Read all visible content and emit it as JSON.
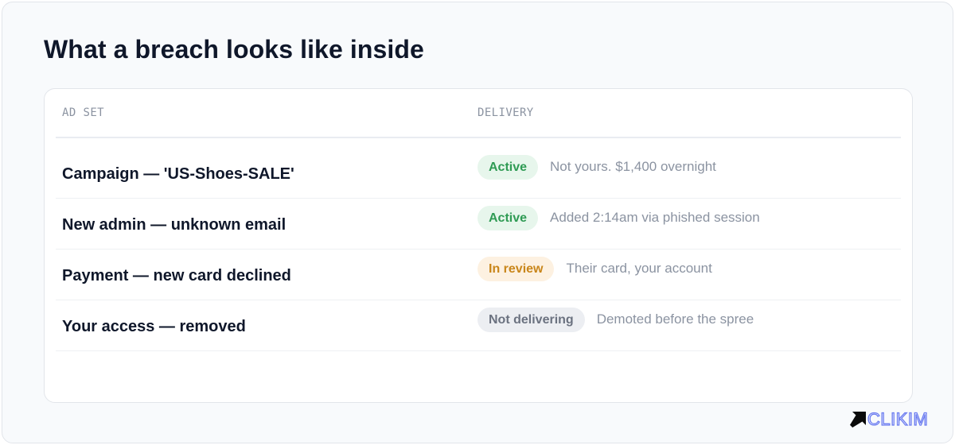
{
  "page": {
    "title": "What a breach looks like inside"
  },
  "table": {
    "columns": {
      "ad_set": "AD SET",
      "delivery": "DELIVERY"
    },
    "rows": [
      {
        "name": "Campaign — 'US-Shoes-SALE'",
        "status": "Active",
        "status_kind": "active",
        "note": "Not yours. $1,400 overnight"
      },
      {
        "name": "New admin — unknown email",
        "status": "Active",
        "status_kind": "active",
        "note": "Added 2:14am via phished session"
      },
      {
        "name": "Payment — new card declined",
        "status": "In review",
        "status_kind": "review",
        "note": "Their card, your account"
      },
      {
        "name": "Your access — removed",
        "status": "Not delivering",
        "status_kind": "off",
        "note": "Demoted before the spree"
      }
    ]
  },
  "brand": {
    "name": "CLIKIM",
    "icon": "arrow-up-right-icon",
    "color": "#6b7cf0"
  },
  "colors": {
    "active_bg": "#e7f6ec",
    "active_text": "#2f9b54",
    "review_bg": "#fdf1e1",
    "review_text": "#c9861a",
    "off_bg": "#eceef2",
    "off_text": "#6b7280"
  }
}
